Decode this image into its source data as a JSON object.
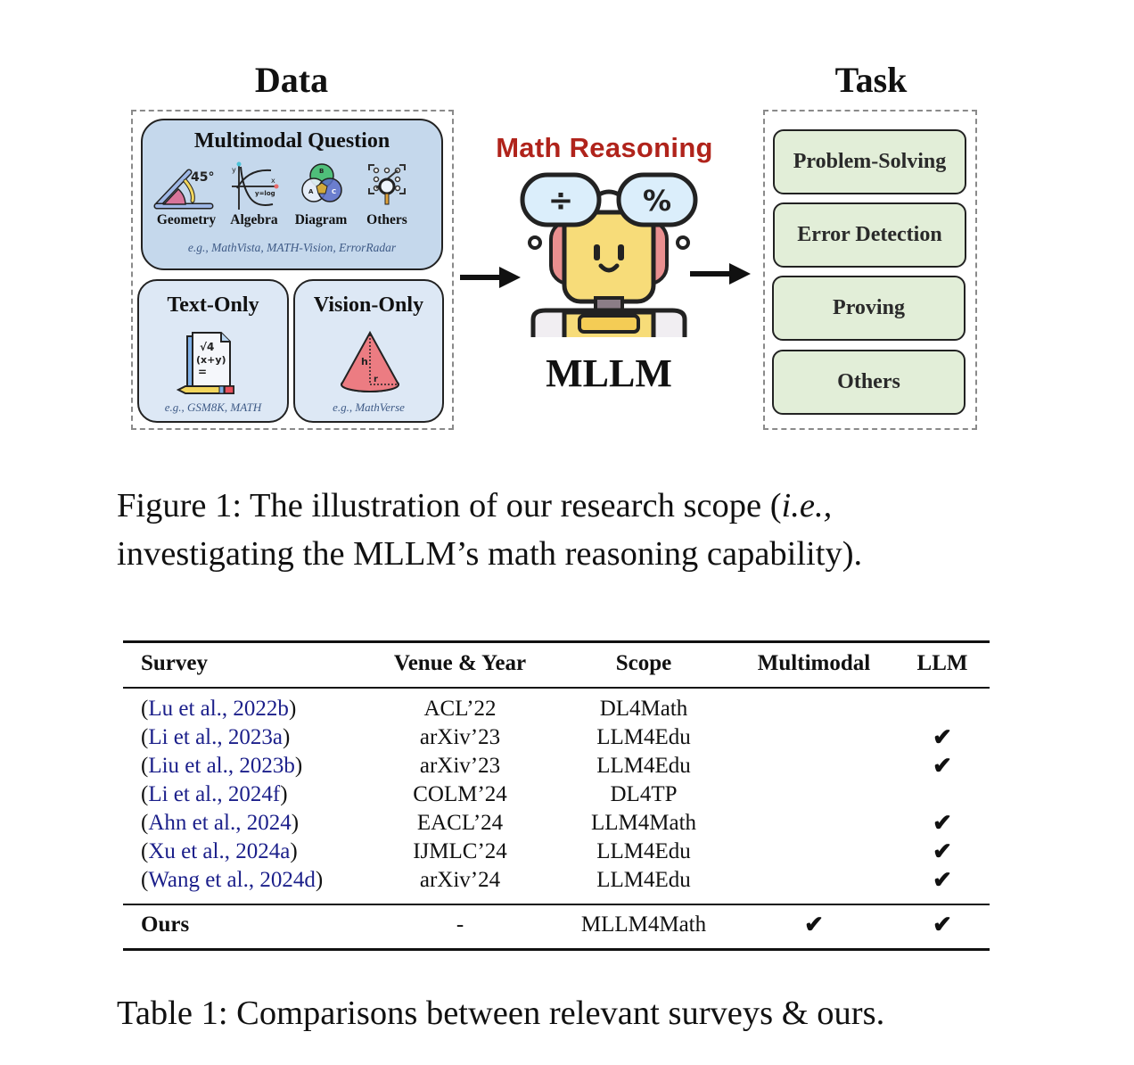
{
  "figure": {
    "data_title": "Data",
    "task_title": "Task",
    "multimodal": {
      "title": "Multimodal Question",
      "categories": [
        {
          "label": "Geometry",
          "icon": "geometry-protractor-icon"
        },
        {
          "label": "Algebra",
          "icon": "algebra-graph-icon"
        },
        {
          "label": "Diagram",
          "icon": "venn-diagram-icon"
        },
        {
          "label": "Others",
          "icon": "scan-magnifier-icon"
        }
      ],
      "examples": "e.g., MathVista, MATH-Vision, ErrorRadar"
    },
    "text_only": {
      "title": "Text-Only",
      "icon": "formula-paper-icon",
      "icon_text": [
        "√4",
        "(x+y)",
        "="
      ],
      "examples": "e.g., GSM8K, MATH"
    },
    "vision_only": {
      "title": "Vision-Only",
      "icon": "cone-icon",
      "icon_text": [
        "h",
        "r"
      ],
      "examples": "e.g., MathVerse"
    },
    "center": {
      "reasoning_label": "Math Reasoning",
      "model_label": "MLLM",
      "robot_glyphs": [
        "÷",
        "%"
      ]
    },
    "tasks": [
      "Problem-Solving",
      "Error Detection",
      "Proving",
      "Others"
    ],
    "algebra_text": {
      "y_axis": "y",
      "x_axis": "x",
      "curve": "y=log"
    },
    "geometry_text": "45°",
    "venn_text": [
      "A",
      "B",
      "C"
    ],
    "colors": {
      "reasoning_red": "#b0231b",
      "multimodal_bg": "#c5d8ec",
      "subbox_bg": "#dde8f5",
      "task_bg": "#e2eed8",
      "example_text": "#3e5a86",
      "citation_blue": "#1b1f8a"
    }
  },
  "figure_caption": {
    "line1_pre": "Figure 1:  The illustration of our research scope (",
    "line1_ie": "i.e.,",
    "line2": "investigating the MLLM’s math reasoning capability)."
  },
  "table": {
    "headers": [
      "Survey",
      "Venue & Year",
      "Scope",
      "Multimodal",
      "LLM"
    ],
    "rows": [
      {
        "survey": "Lu et al., 2022b",
        "venue": "ACL’22",
        "scope": "DL4Math",
        "multimodal": "",
        "llm": ""
      },
      {
        "survey": "Li et al., 2023a",
        "venue": "arXiv’23",
        "scope": "LLM4Edu",
        "multimodal": "",
        "llm": "✔"
      },
      {
        "survey": "Liu et al., 2023b",
        "venue": "arXiv’23",
        "scope": "LLM4Edu",
        "multimodal": "",
        "llm": "✔"
      },
      {
        "survey": "Li et al., 2024f",
        "venue": "COLM’24",
        "scope": "DL4TP",
        "multimodal": "",
        "llm": ""
      },
      {
        "survey": "Ahn et al., 2024",
        "venue": "EACL’24",
        "scope": "LLM4Math",
        "multimodal": "",
        "llm": "✔"
      },
      {
        "survey": "Xu et al., 2024a",
        "venue": "IJMLC’24",
        "scope": "LLM4Edu",
        "multimodal": "",
        "llm": "✔"
      },
      {
        "survey": "Wang et al., 2024d",
        "venue": "arXiv’24",
        "scope": "LLM4Edu",
        "multimodal": "",
        "llm": "✔"
      }
    ],
    "ours": {
      "survey": "Ours",
      "venue": "-",
      "scope": "MLLM4Math",
      "multimodal": "✔",
      "llm": "✔"
    },
    "paren_open": "(",
    "paren_close": ")"
  },
  "table_caption": "Table 1: Comparisons between relevant surveys & ours."
}
